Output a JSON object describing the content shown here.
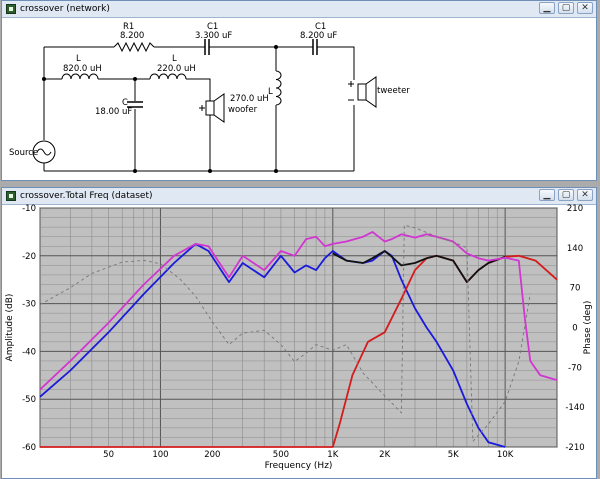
{
  "network_window": {
    "title": "crossover (network)",
    "components": {
      "r1_name": "R1",
      "r1_value": "8.200",
      "c1a_name": "C1",
      "c1a_value": "3.300 uF",
      "c1b_name": "C1",
      "c1b_value": "8.200 uF",
      "l1_name": "L",
      "l1_value": "820.0 uH",
      "l2_name": "L",
      "l2_value": "220.0 uH",
      "c_name": "C",
      "c_value": "18.00 uF",
      "l3_name": "L",
      "l3_value": "270.0 uH",
      "woofer": "woofer",
      "tweeter": "tweeter",
      "source": "Source"
    }
  },
  "freq_window": {
    "title": "crossover.Total Freq (dataset)",
    "xlabel": "Frequency (Hz)",
    "ylabel_left": "Amplitude (dB)",
    "ylabel_right": "Phase (deg)"
  },
  "chart_data": {
    "type": "line",
    "xlabel": "Frequency (Hz)",
    "ylabel": "Amplitude (dB)",
    "y2label": "Phase (deg)",
    "xscale": "log",
    "xlim": [
      20,
      20000
    ],
    "ylim": [
      -60,
      -10
    ],
    "y2lim": [
      -210,
      210
    ],
    "x_ticks": [
      "50",
      "100",
      "200",
      "500",
      "1K",
      "2K",
      "5K",
      "10K"
    ],
    "y_ticks": [
      "-10",
      "-20",
      "-30",
      "-40",
      "-50",
      "-60"
    ],
    "y2_ticks": [
      "210",
      "140",
      "70",
      "0",
      "-70",
      "-140",
      "-210"
    ],
    "grid": true,
    "series": [
      {
        "color": "#1a1add",
        "x": [
          20,
          30,
          50,
          80,
          120,
          160,
          190,
          220,
          250,
          300,
          400,
          500,
          600,
          700,
          800,
          900,
          1000,
          1200,
          1500,
          1700,
          2000,
          2200,
          2500,
          3000,
          3500,
          4000,
          5000,
          6000,
          7000,
          8000,
          10000
        ],
        "y": [
          -49.5,
          -44,
          -36,
          -28,
          -21.5,
          -17.5,
          -19,
          -22.5,
          -25.5,
          -21.5,
          -24.5,
          -20,
          -23.5,
          -22,
          -23,
          -20.5,
          -19,
          -21,
          -21.5,
          -21,
          -19,
          -20,
          -25,
          -31,
          -35,
          -38,
          -44,
          -51,
          -56,
          -59,
          -60
        ]
      },
      {
        "color": "#d41c1c",
        "x": [
          20,
          1000,
          1100,
          1300,
          1600,
          2000,
          2500,
          3000,
          3500,
          4000,
          5000,
          6000,
          7000,
          8000,
          10000,
          12000,
          15000,
          20000
        ],
        "y": [
          -60,
          -60,
          -55,
          -45,
          -38,
          -36,
          -29,
          -23,
          -20.5,
          -20,
          -21,
          -25.5,
          -23,
          -21.5,
          -20.2,
          -20,
          -21,
          -25
        ]
      },
      {
        "color": "#111111",
        "x": [
          1000,
          1200,
          1500,
          1700,
          2000,
          2200,
          2500,
          3000,
          3500,
          4000,
          5000,
          6000,
          7000,
          8000,
          10000
        ],
        "y": [
          -19.5,
          -21,
          -21.5,
          -20.5,
          -19,
          -20.2,
          -22,
          -21.5,
          -20.5,
          -20,
          -21,
          -25.5,
          -23,
          -21.5,
          -20.2
        ]
      },
      {
        "color": "#d235d2",
        "x": [
          20,
          30,
          50,
          80,
          120,
          160,
          190,
          220,
          250,
          300,
          400,
          500,
          600,
          700,
          800,
          900,
          1000,
          1200,
          1500,
          1700,
          2000,
          2200,
          2500,
          3000,
          3500,
          4000,
          5000,
          6000,
          7000,
          8000,
          10000,
          12000,
          13000,
          14000,
          16000,
          20000
        ],
        "y": [
          -48,
          -42,
          -34,
          -26,
          -20,
          -17.5,
          -18,
          -21.5,
          -24.5,
          -20,
          -23,
          -19,
          -20,
          -16.5,
          -16,
          -18,
          -17.5,
          -17,
          -16,
          -15,
          -17,
          -16.5,
          -15.5,
          -16.2,
          -15.5,
          -16,
          -17,
          -19.5,
          -20.5,
          -21,
          -20.4,
          -21,
          -33,
          -42,
          -45,
          -46
        ]
      },
      {
        "color": "#777777",
        "dash": "3,3",
        "axis": "right",
        "x": [
          20,
          30,
          40,
          60,
          80,
          100,
          130,
          160,
          200,
          250,
          300,
          400,
          500,
          600,
          700,
          800,
          1000,
          1200,
          1500,
          2000,
          2500,
          2600,
          3000,
          4000,
          5000,
          6000,
          6500,
          8000,
          10000,
          12000,
          14000
        ],
        "y": [
          40,
          70,
          95,
          115,
          118,
          112,
          85,
          55,
          10,
          -30,
          -10,
          -5,
          -30,
          -60,
          -45,
          -30,
          -40,
          -30,
          -80,
          -120,
          -150,
          180,
          175,
          160,
          150,
          140,
          -200,
          -170,
          -130,
          -60,
          60
        ]
      }
    ]
  }
}
